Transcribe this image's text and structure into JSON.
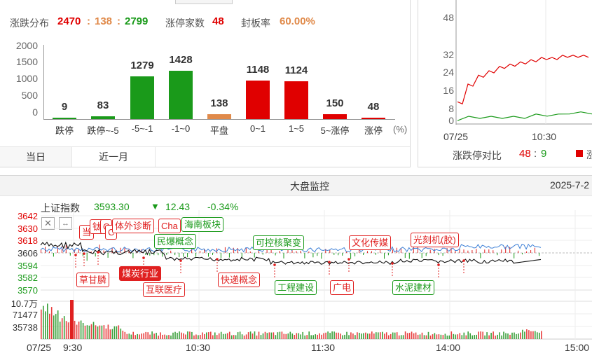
{
  "summary": {
    "label_dist": "涨跌分布",
    "up": "2470",
    "sep1": ":",
    "flat": "138",
    "sep2": ":",
    "down": "2799",
    "label_limit": "涨停家数",
    "limit_count": "48",
    "label_seal": "封板率",
    "seal_rate": "60.00%"
  },
  "chart_data": [
    {
      "type": "bar",
      "title": "",
      "categories": [
        "跌停",
        "跌停~-5",
        "-5~-1",
        "-1~0",
        "平盘",
        "0~1",
        "1~5",
        "5~涨停",
        "涨停"
      ],
      "values": [
        9,
        83,
        1279,
        1428,
        138,
        1148,
        1124,
        150,
        48
      ],
      "colors": [
        "#1a9a1a",
        "#1a9a1a",
        "#1a9a1a",
        "#1a9a1a",
        "#e08a4a",
        "#e00000",
        "#e00000",
        "#e00000",
        "#e00000"
      ],
      "yticks": [
        "2000",
        "1500",
        "1000",
        "500",
        "0"
      ],
      "ylim": [
        0,
        2000
      ],
      "unit": "(%)"
    },
    {
      "type": "line",
      "yticks": [
        "48",
        "32",
        "24",
        "16",
        "8",
        "0"
      ],
      "xticks": [
        "07/25",
        "10:30"
      ],
      "series": [
        {
          "color": "#e00000",
          "values": [
            10,
            18,
            22,
            24,
            26,
            27,
            28,
            29,
            30,
            30,
            31,
            31,
            31
          ]
        },
        {
          "color": "#1a9a1a",
          "values": [
            2,
            3,
            3,
            3,
            3,
            3,
            3,
            4,
            4,
            4,
            5,
            5,
            5
          ]
        }
      ]
    },
    {
      "type": "line",
      "yticks_red": [
        "3642",
        "3630",
        "3618"
      ],
      "ytick_mid": "3606",
      "yticks_green": [
        "3594",
        "3582",
        "3570"
      ],
      "vol_ticks": [
        "10.7万",
        "71477",
        "35738"
      ],
      "xticks": [
        "07/25",
        "9:30",
        "10:30",
        "11:30",
        "14:00",
        "15:00"
      ]
    }
  ],
  "tabs": {
    "today": "当日",
    "month": "近一月"
  },
  "ratio": {
    "label": "涨跌停对比",
    "up": "48",
    "sep": ":",
    "down": "9",
    "legend_partial": "涨"
  },
  "monitor": {
    "title": "大盘监控",
    "date": "2025-7-2",
    "index_name": "上证指数",
    "index_value": "3593.30",
    "arrow": "▼",
    "change": "12.43",
    "pct": "-0.34%"
  },
  "annotations": {
    "a1": "当",
    "a2": "钛",
    "a3": "C",
    "a4": "体外诊断",
    "a5": "Cha",
    "a6": "海南板块",
    "a7": "民爆概念",
    "a8": "可控核聚变",
    "a9": "文化传媒",
    "a10": "光刻机(胶)",
    "a11": "草甘膦",
    "a12": "煤炭行业",
    "a13": "互联医疗",
    "a14": "快递概念",
    "a15": "工程建设",
    "a16": "广电",
    "a17": "水泥建材",
    "a18": "C"
  }
}
